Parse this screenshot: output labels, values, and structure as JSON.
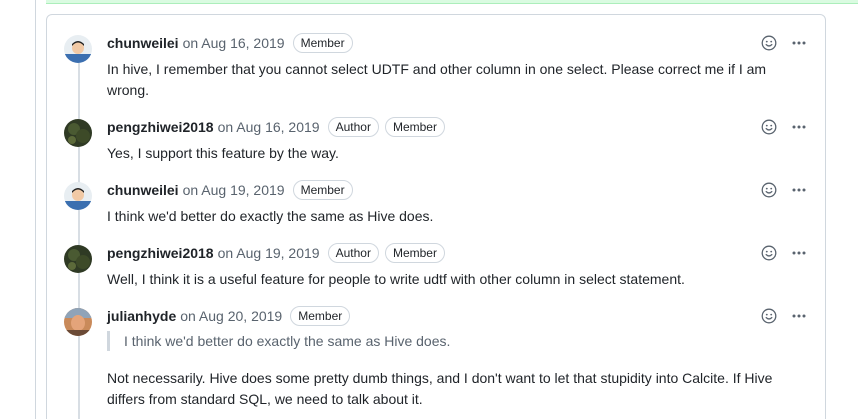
{
  "comments": [
    {
      "author": "chunweilei",
      "on_date": "on Aug 16, 2019",
      "badges": [
        "Member"
      ],
      "avatar": "avatar-chunweilei",
      "body": "In hive, I remember that you cannot select UDTF and other column in one select. Please correct me if I am wrong."
    },
    {
      "author": "pengzhiwei2018",
      "on_date": "on Aug 16, 2019",
      "badges": [
        "Author",
        "Member"
      ],
      "avatar": "avatar-pengzhiwei2018",
      "body": "Yes, I support this feature by the way."
    },
    {
      "author": "chunweilei",
      "on_date": "on Aug 19, 2019",
      "badges": [
        "Member"
      ],
      "avatar": "avatar-chunweilei",
      "body": "I think we'd better do exactly the same as Hive does."
    },
    {
      "author": "pengzhiwei2018",
      "on_date": "on Aug 19, 2019",
      "badges": [
        "Author",
        "Member"
      ],
      "avatar": "avatar-pengzhiwei2018",
      "body": "Well, I think it is a useful feature for people to write udtf with other column in select statement."
    },
    {
      "author": "julianhyde",
      "on_date": "on Aug 20, 2019",
      "badges": [
        "Member"
      ],
      "avatar": "avatar-julianhyde",
      "quote": "I think we'd better do exactly the same as Hive does.",
      "body": "Not necessarily. Hive does some pretty dumb things, and I don't want to let that stupidity into Calcite. If Hive differs from standard SQL, we need to talk about it."
    }
  ],
  "icons": {
    "reaction": "smiley-icon",
    "more": "kebab-horizontal-icon"
  },
  "colors": {
    "border": "#d0d7de",
    "muted_text": "#59636e",
    "text": "#1f2328",
    "success_strip": "#dafbe1"
  }
}
